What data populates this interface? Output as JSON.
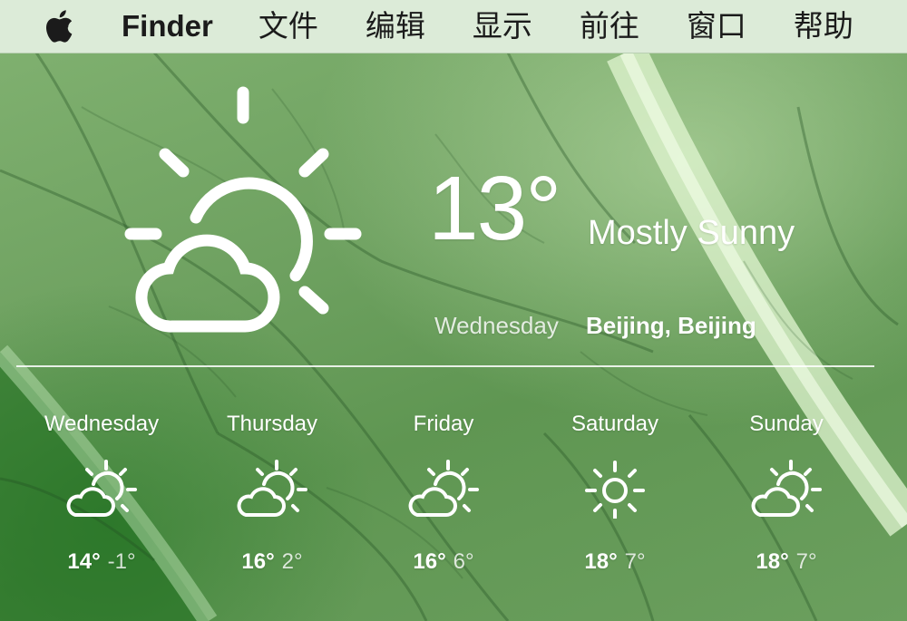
{
  "menubar": {
    "apple_icon": "apple-logo-icon",
    "app_name": "Finder",
    "items": [
      "文件",
      "编辑",
      "显示",
      "前往",
      "窗口",
      "帮助"
    ]
  },
  "current": {
    "icon": "partly-sunny-icon",
    "temperature": "13°",
    "condition": "Mostly Sunny",
    "day": "Wednesday",
    "location": "Beijing, Beijing"
  },
  "forecast": [
    {
      "day": "Wednesday",
      "icon": "partly-sunny-icon",
      "high": "14°",
      "low": "-1°"
    },
    {
      "day": "Thursday",
      "icon": "partly-sunny-icon",
      "high": "16°",
      "low": "2°"
    },
    {
      "day": "Friday",
      "icon": "partly-sunny-icon",
      "high": "16°",
      "low": "6°"
    },
    {
      "day": "Saturday",
      "icon": "sunny-icon",
      "high": "18°",
      "low": "7°"
    },
    {
      "day": "Sunday",
      "icon": "partly-sunny-icon",
      "high": "18°",
      "low": "7°"
    }
  ],
  "colors": {
    "menubar_bg": "#dcebd8",
    "wallpaper_green": "#6ea160",
    "text": "#ffffff"
  }
}
